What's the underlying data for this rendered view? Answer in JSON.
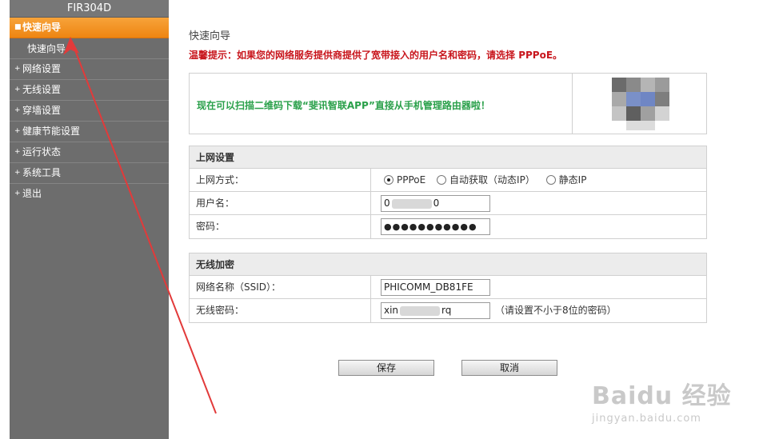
{
  "brand": "FIR304D",
  "sidebar": {
    "items": [
      {
        "label": "快速向导",
        "active": true
      },
      {
        "label": "快速向导",
        "sub": true
      },
      {
        "label": "网络设置"
      },
      {
        "label": "无线设置"
      },
      {
        "label": "穿墙设置"
      },
      {
        "label": "健康节能设置"
      },
      {
        "label": "运行状态"
      },
      {
        "label": "系统工具"
      },
      {
        "label": "退出"
      }
    ]
  },
  "main": {
    "title": "快速向导",
    "hint_prefix": "温馨提示：",
    "hint_text": "如果您的网络服务提供商提供了宽带接入的用户名和密码，请选择 PPPoE。",
    "qr_text": "现在可以扫描二维码下载“斐讯智联APP”直接从手机管理路由器啦！"
  },
  "internet": {
    "heading": "上网设置",
    "mode_label": "上网方式：",
    "modes": [
      "PPPoE",
      "自动获取（动态IP）",
      "静态IP"
    ],
    "selected_mode": "PPPoE",
    "username_label": "用户名：",
    "username_start": "0",
    "username_end": "0",
    "password_label": "密码：",
    "password_value": "●●●●●●●●●●●"
  },
  "wireless": {
    "heading": "无线加密",
    "ssid_label": "网络名称（SSID）：",
    "ssid_value": "PHICOMM_DB81FE",
    "password_label": "无线密码：",
    "password_start": "xin",
    "password_end": "rq",
    "password_note": "（请设置不小于8位的密码）"
  },
  "buttons": {
    "save": "保存",
    "cancel": "取消"
  },
  "watermark": {
    "main": "Baidu 经验",
    "sub": "jingyan.baidu.com"
  },
  "colors": {
    "sidebar_bg": "#6d6d6d",
    "active_item": "#f39a2a",
    "hint_red": "#c8161d",
    "qr_green": "#2aa04a",
    "arrow_red": "#e23a3a"
  }
}
